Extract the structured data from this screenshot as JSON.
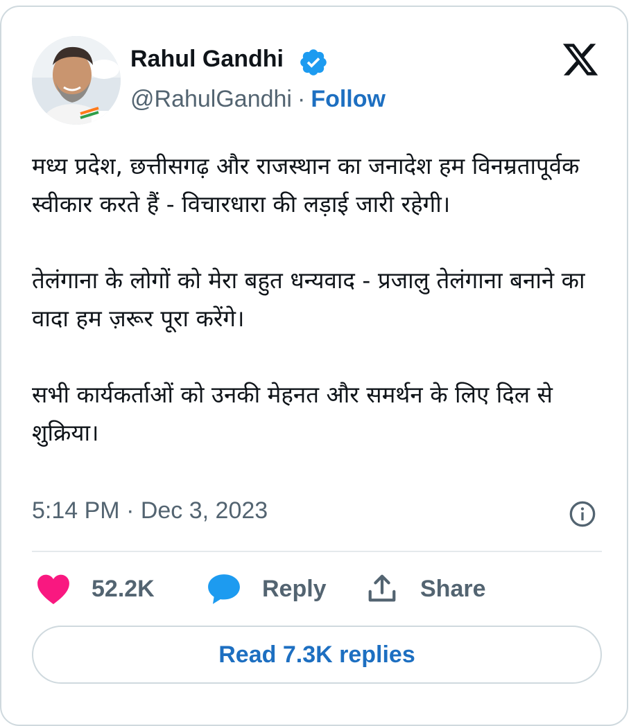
{
  "author": {
    "name": "Rahul Gandhi",
    "handle": "@RahulGandhi",
    "separator": "·",
    "follow_label": "Follow",
    "verified": true
  },
  "icons": {
    "platform_logo": "x-logo-icon",
    "verified_badge": "verified-badge-icon",
    "info": "info-icon",
    "like": "heart-icon",
    "reply": "reply-bubble-icon",
    "share": "share-icon"
  },
  "tweet": {
    "paragraphs": [
      "मध्य प्रदेश, छत्तीसगढ़ और राजस्थान का जनादेश हम विनम्रतापूर्वक स्वीकार करते हैं - विचारधारा की लड़ाई जारी रहेगी।",
      "तेलंगाना के लोगों को मेरा बहुत धन्यवाद - प्रजालु तेलंगाना बनाने का वादा हम ज़रूर पूरा करेंगे।",
      "सभी कार्यकर्ताओं को उनकी मेहनत और समर्थन के लिए दिल से शुक्रिया।"
    ],
    "timestamp": "5:14 PM · Dec 3, 2023"
  },
  "actions": {
    "likes_count": "52.2K",
    "reply_label": "Reply",
    "share_label": "Share"
  },
  "read_replies_label": "Read 7.3K replies",
  "colors": {
    "accent": "#1d6fc1",
    "verified": "#1d9bf0",
    "like": "#f91880",
    "reply_icon": "#1d9bf0",
    "muted_text": "#536471",
    "border": "#cfd9de"
  }
}
